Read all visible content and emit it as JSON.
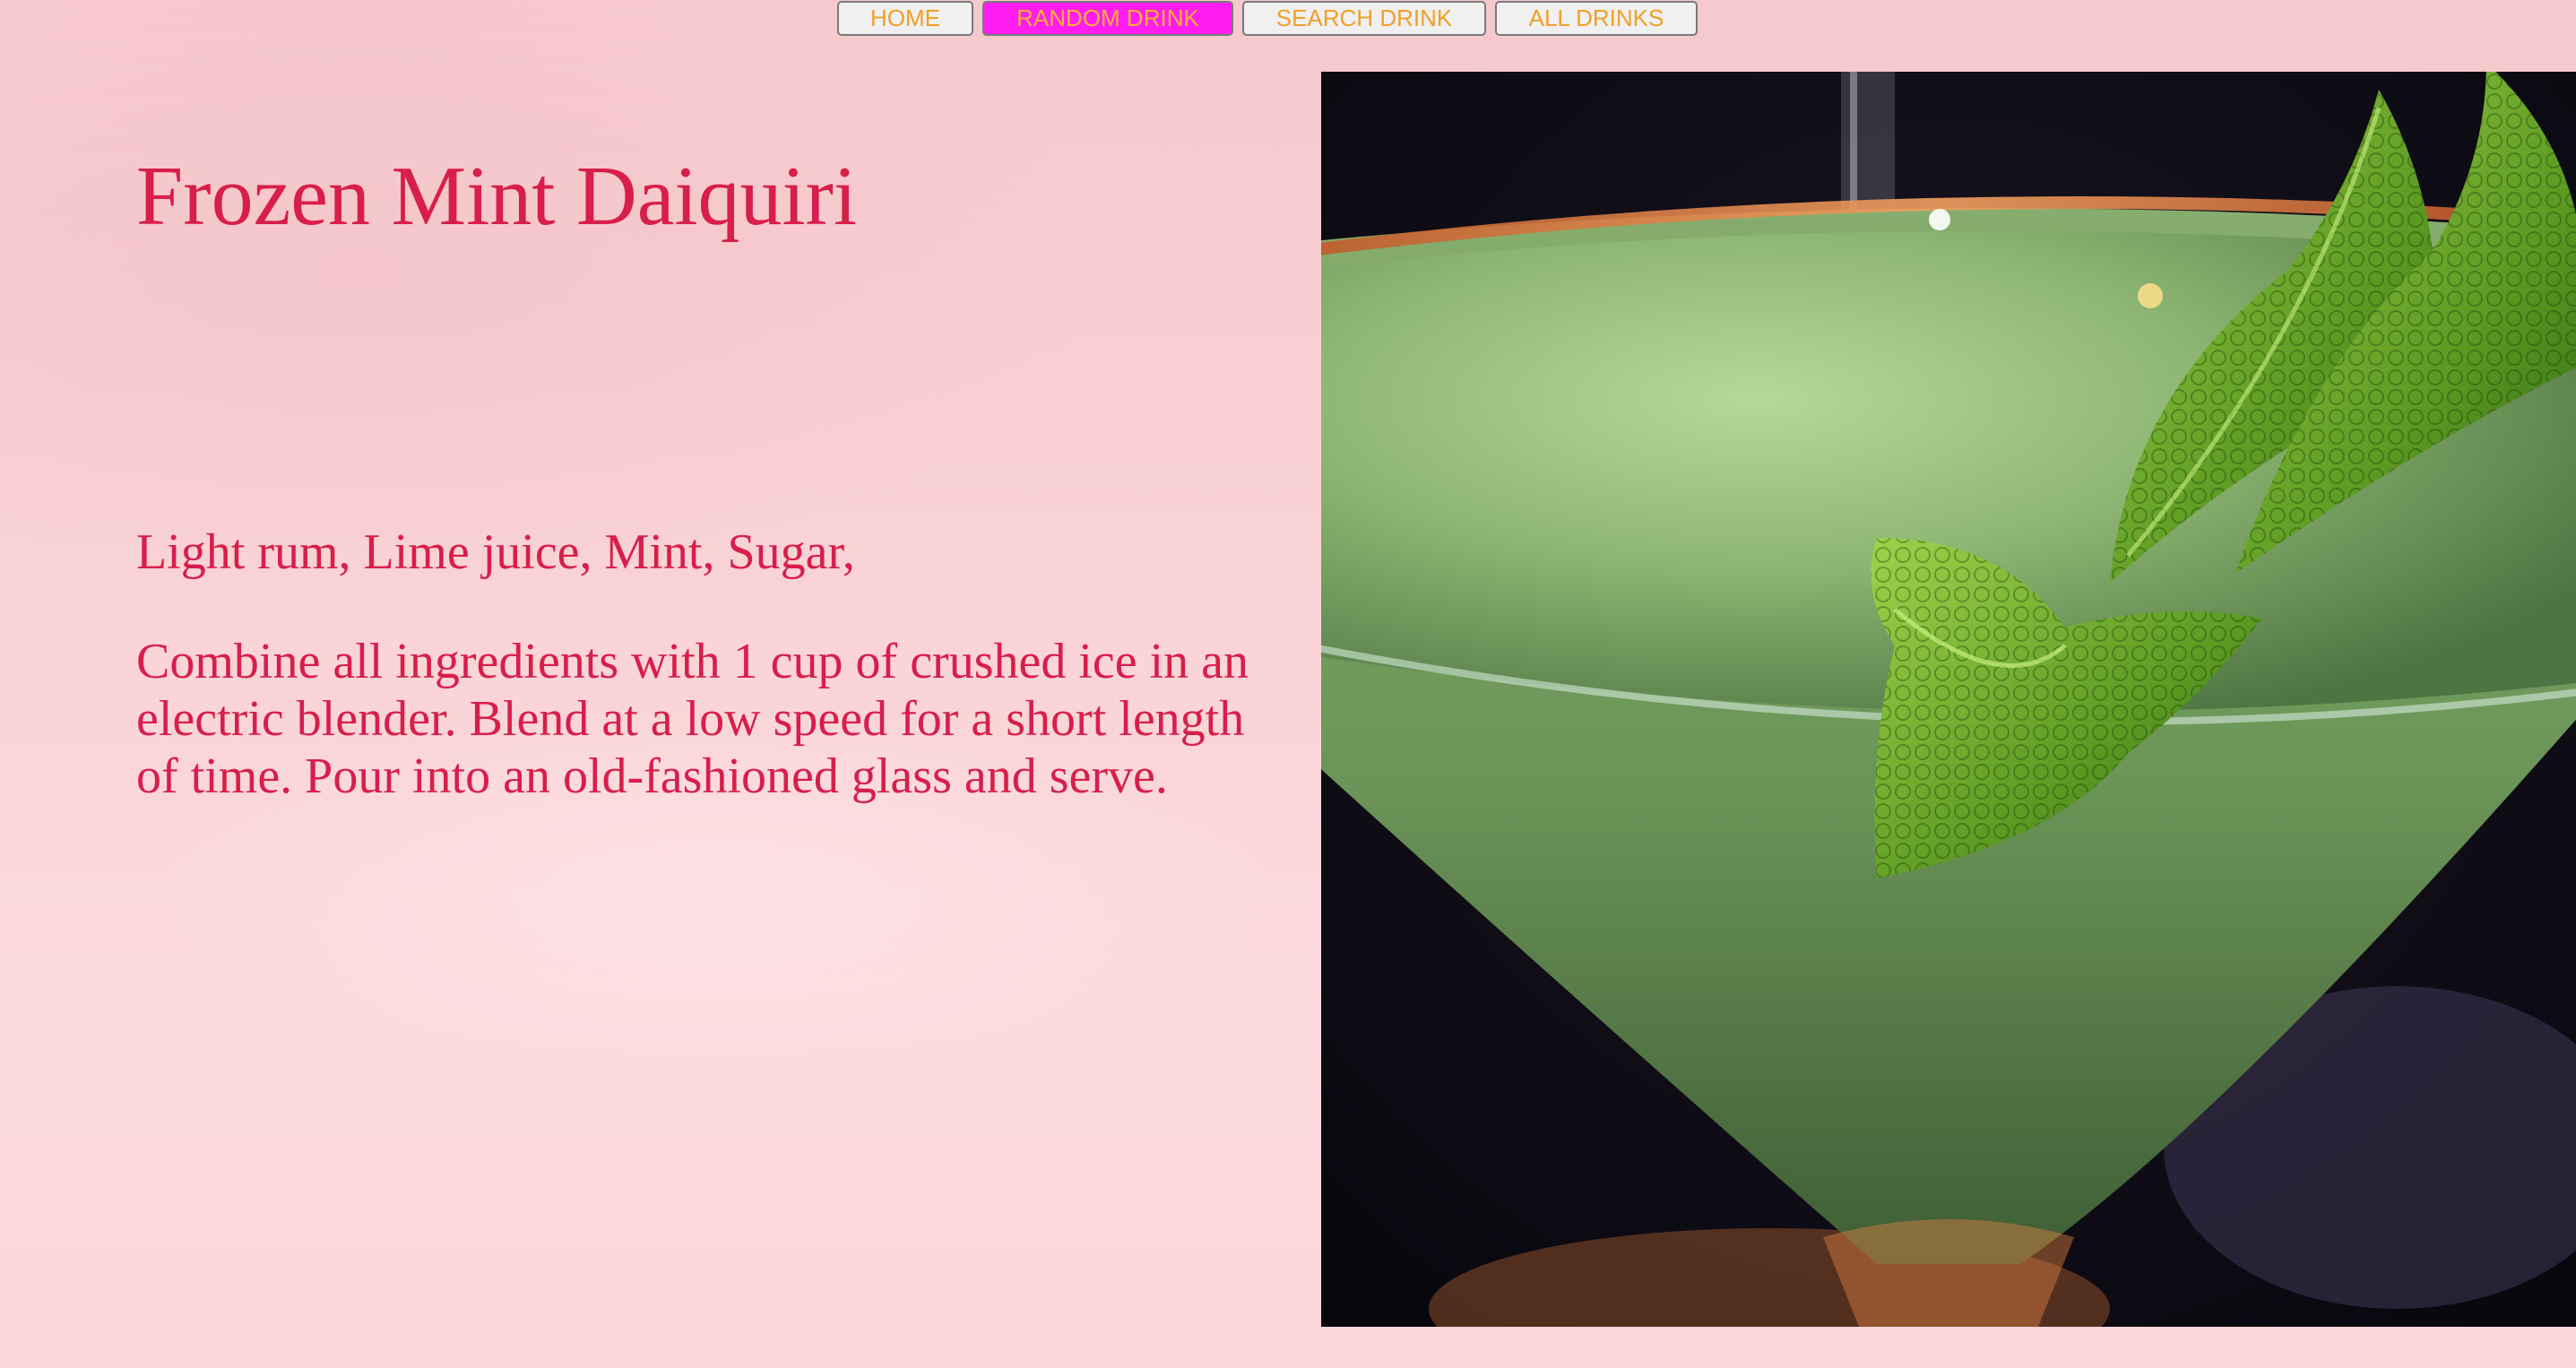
{
  "nav": {
    "home": "HOME",
    "random": "RANDOM DRINK",
    "search": "SEARCH DRINK",
    "all": "ALL DRINKS",
    "active_color": "#ff1cf0",
    "label_color": "#f0a028"
  },
  "drink": {
    "title": "Frozen Mint Daiquiri",
    "ingredients": "Light rum, Lime juice, Mint, Sugar,",
    "instructions": "Combine all ingredients with 1 cup of crushed ice in an electric blender. Blend at a low speed for a short length of time. Pour into an old-fashioned glass and serve.",
    "text_color": "#d81e4a"
  },
  "image": {
    "subject": "frozen-mint-daiquiri-photo"
  }
}
